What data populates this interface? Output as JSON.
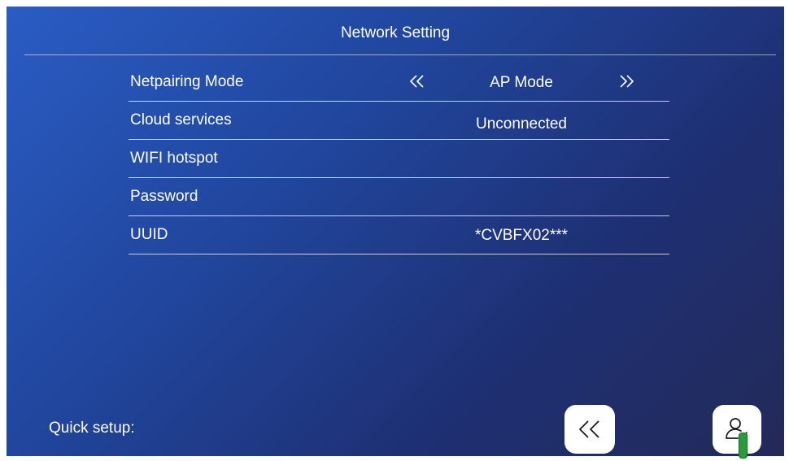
{
  "header": {
    "title": "Network Setting"
  },
  "rows": [
    {
      "label": "Netpairing Mode",
      "value": "AP Mode"
    },
    {
      "label": "Cloud services",
      "value": "Unconnected"
    },
    {
      "label": "WIFI hotspot",
      "value": ""
    },
    {
      "label": "Password",
      "value": ""
    },
    {
      "label": "UUID",
      "value": "*CVBFX02***"
    }
  ],
  "footer": {
    "quick_setup_label": "Quick setup:"
  },
  "icons": {
    "mode_prev": "double-chevron-left-icon",
    "mode_next": "double-chevron-right-icon",
    "back": "double-chevron-left-icon",
    "user": "user-check-icon"
  },
  "colors": {
    "background_start": "#2a5cc4",
    "background_end": "#232a58",
    "text": "#ffffff",
    "handle": "#2b9a3e"
  }
}
